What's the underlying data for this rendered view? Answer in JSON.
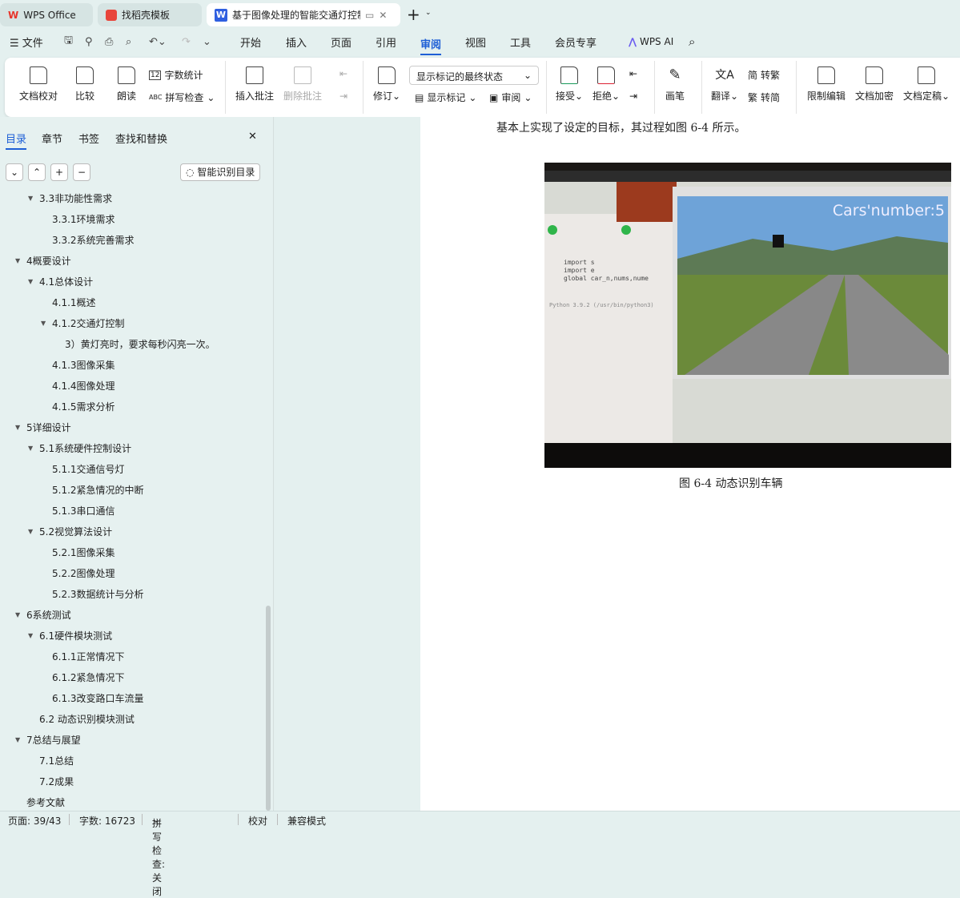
{
  "tabs": [
    {
      "label": "WPS Office",
      "icon": "wps-logo-icon"
    },
    {
      "label": "找稻壳模板",
      "icon": "docer-icon"
    },
    {
      "label": "基于图像处理的智能交通灯控制",
      "icon": "word-doc-icon"
    }
  ],
  "menu": {
    "file": "文件",
    "items": [
      "开始",
      "插入",
      "页面",
      "引用",
      "审阅",
      "视图",
      "工具",
      "会员专享"
    ],
    "active": "审阅",
    "ai": "WPS AI"
  },
  "ribbon": {
    "doc_proof": "文档校对",
    "compare": "比较",
    "read": "朗读",
    "word_count": "字数统计",
    "spell_check": "拼写检查",
    "insert_comment": "插入批注",
    "delete_comment": "删除批注",
    "revise": "修订",
    "markup_select": "显示标记的最终状态",
    "show_markup": "显示标记",
    "review": "审阅",
    "accept": "接受",
    "reject": "拒绝",
    "pen": "画笔",
    "translate": "翻译",
    "to_trad": "转繁",
    "to_simp": "转简",
    "restrict_edit": "限制编辑",
    "encrypt": "文档加密",
    "finalize": "文档定稿"
  },
  "panel": {
    "tabs": [
      "目录",
      "章节",
      "书签",
      "查找和替换"
    ],
    "active": "目录",
    "smart_toc": "智能识别目录"
  },
  "toc": [
    {
      "label": "3.3非功能性需求",
      "level": 1,
      "expanded": true
    },
    {
      "label": "3.3.1环境需求",
      "level": 2
    },
    {
      "label": "3.3.2系统完善需求",
      "level": 2
    },
    {
      "label": "4概要设计",
      "level": 0,
      "expanded": true
    },
    {
      "label": "4.1总体设计",
      "level": 1,
      "expanded": true
    },
    {
      "label": "4.1.1概述",
      "level": 2
    },
    {
      "label": "4.1.2交通灯控制",
      "level": 2,
      "expanded": true
    },
    {
      "label": "3）黄灯亮时，要求每秒闪亮一次。",
      "level": 3
    },
    {
      "label": "4.1.3图像采集",
      "level": 2
    },
    {
      "label": "4.1.4图像处理",
      "level": 2
    },
    {
      "label": "4.1.5需求分析",
      "level": 2
    },
    {
      "label": "5详细设计",
      "level": 0,
      "expanded": true
    },
    {
      "label": "5.1系统硬件控制设计",
      "level": 1,
      "expanded": true
    },
    {
      "label": "5.1.1交通信号灯",
      "level": 2
    },
    {
      "label": "5.1.2紧急情况的中断",
      "level": 2
    },
    {
      "label": "5.1.3串口通信",
      "level": 2
    },
    {
      "label": "5.2视觉算法设计",
      "level": 1,
      "expanded": true
    },
    {
      "label": "5.2.1图像采集",
      "level": 2
    },
    {
      "label": "5.2.2图像处理",
      "level": 2
    },
    {
      "label": "5.2.3数据统计与分析",
      "level": 2
    },
    {
      "label": "6系统测试",
      "level": 0,
      "expanded": true
    },
    {
      "label": "6.1硬件模块测试",
      "level": 1,
      "expanded": true
    },
    {
      "label": "6.1.1正常情况下",
      "level": 2
    },
    {
      "label": "6.1.2紧急情况下",
      "level": 2
    },
    {
      "label": "6.1.3改变路口车流量",
      "level": 2
    },
    {
      "label": "6.2 动态识别模块测试",
      "level": 1
    },
    {
      "label": "7总结与展望",
      "level": 0,
      "expanded": true
    },
    {
      "label": "7.1总结",
      "level": 1
    },
    {
      "label": "7.2成果",
      "level": 1
    },
    {
      "label": "参考文献",
      "level": 0
    }
  ],
  "document": {
    "text": "基本上实现了设定的目标，其过程如图  6-4 所示。",
    "caption": "图  6-4 动态识别车辆",
    "photo_overlay": "Cars'number:5"
  },
  "status": {
    "page": "页面: 39/43",
    "words": "字数: 16723",
    "spell": "拼写检查: 关闭",
    "proof": "校对",
    "compat": "兼容模式"
  },
  "colors": {
    "accent": "#1e5fd6",
    "wps_red": "#e8352b"
  }
}
